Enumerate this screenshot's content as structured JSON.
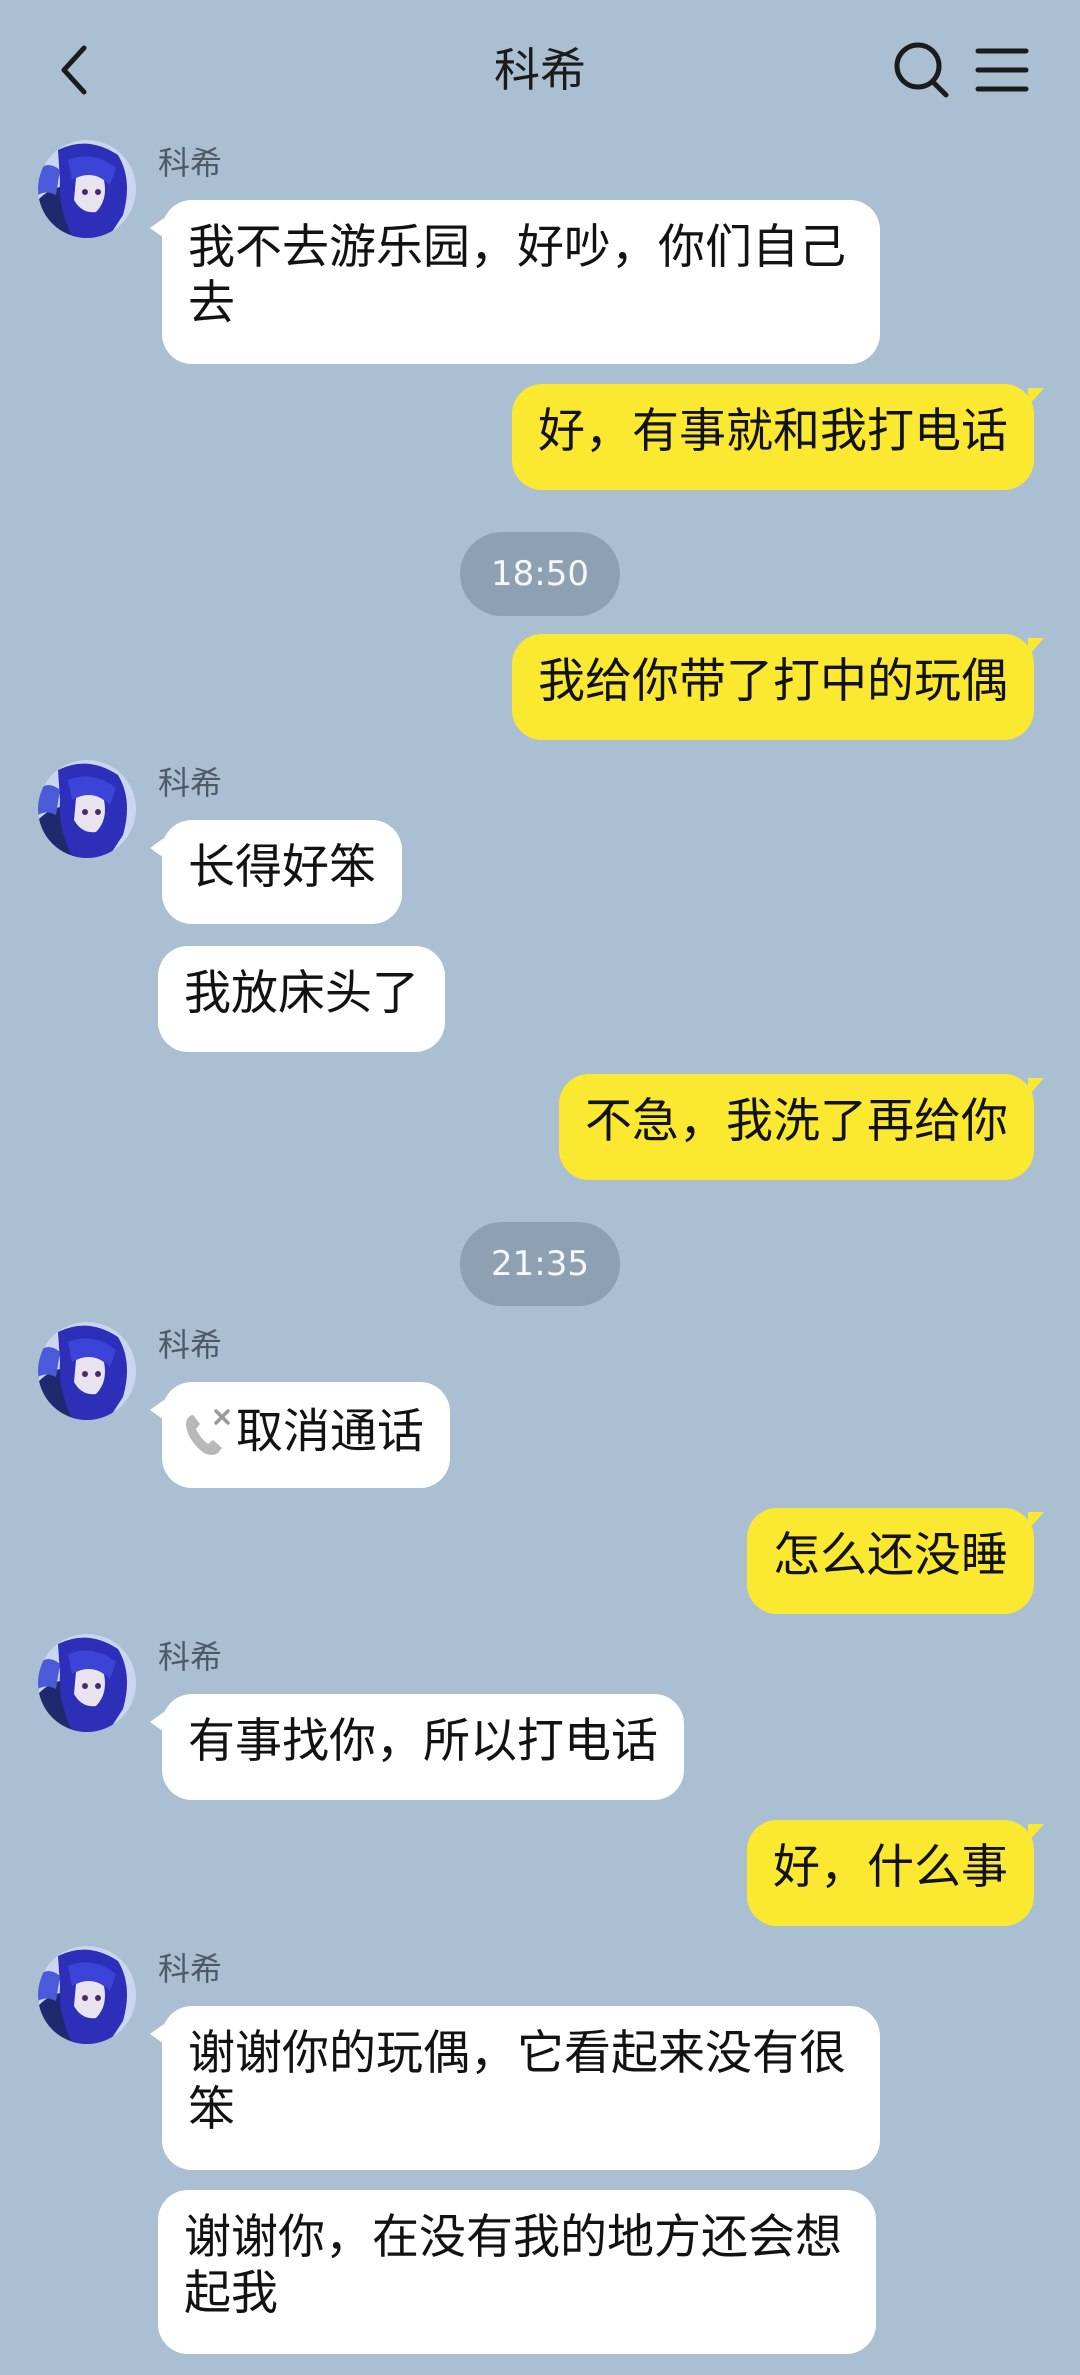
{
  "header": {
    "title": "科希",
    "back_icon": "chevron-left-icon",
    "search_icon": "search-icon",
    "menu_icon": "menu-icon"
  },
  "messages": [
    {
      "side": "left",
      "sender": "科希",
      "text": "我不去游乐园，好吵，你们自己去"
    },
    {
      "side": "right",
      "text": "好，有事就和我打电话"
    },
    {
      "type": "time",
      "text": "18:50"
    },
    {
      "side": "right",
      "text": "我给你带了打中的玩偶"
    },
    {
      "side": "left",
      "sender": "科希",
      "text": "长得好笨"
    },
    {
      "side": "left",
      "text": "我放床头了"
    },
    {
      "side": "right",
      "text": "不急，我洗了再给你"
    },
    {
      "type": "time",
      "text": "21:35"
    },
    {
      "side": "left",
      "sender": "科希",
      "text": "取消通话",
      "icon": "cancelled-call-icon"
    },
    {
      "side": "right",
      "text": "怎么还没睡"
    },
    {
      "side": "left",
      "sender": "科希",
      "text": "有事找你，所以打电话"
    },
    {
      "side": "right",
      "text": "好，什么事"
    },
    {
      "side": "left",
      "sender": "科希",
      "text": "谢谢你的玩偶，它看起来没有很笨"
    },
    {
      "side": "left",
      "text": "谢谢你，在没有我的地方还会想起我"
    }
  ],
  "colors": {
    "background": "#aabfd1",
    "incoming_bubble": "#ffffff",
    "outgoing_bubble": "#fbe931",
    "time_pill": "#8ea1b2"
  }
}
